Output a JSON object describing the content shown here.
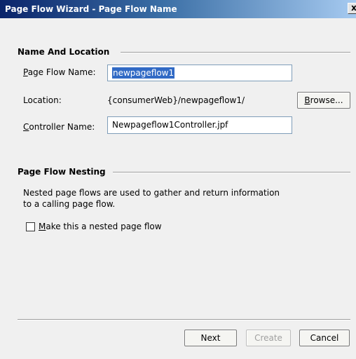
{
  "window": {
    "title": "Page Flow Wizard - Page Flow Name",
    "close_glyph": "x"
  },
  "section_name_location": {
    "title": "Name And Location"
  },
  "page_flow_name": {
    "label_mnemonic": "P",
    "label_rest": "age Flow Name:",
    "value": "newpageflow1"
  },
  "location": {
    "label": "Location:",
    "value": "{consumerWeb}/newpageflow1/",
    "browse_mnemonic": "B",
    "browse_rest": "rowse..."
  },
  "controller_name": {
    "label_mnemonic": "C",
    "label_rest": "ontroller Name:",
    "value": "Newpageflow1Controller.jpf"
  },
  "section_nesting": {
    "title": "Page Flow Nesting",
    "description_line1": "Nested page flows are used to gather and return information",
    "description_line2": "to a calling page flow.",
    "checkbox_mnemonic": "M",
    "checkbox_rest": "ake this a nested page flow",
    "checked": false
  },
  "footer": {
    "next_label": "Next",
    "create_label": "Create",
    "cancel_label": "Cancel"
  }
}
